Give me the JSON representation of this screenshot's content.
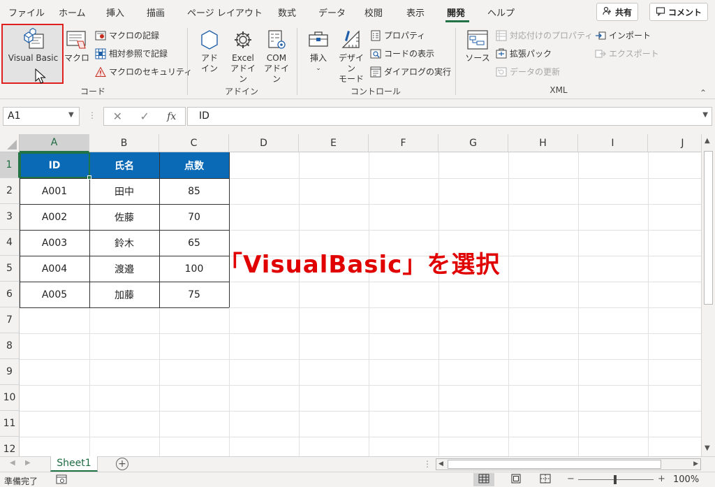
{
  "tabs": [
    "ファイル",
    "ホーム",
    "挿入",
    "描画",
    "ページ レイアウト",
    "数式",
    "データ",
    "校閲",
    "表示",
    "開発",
    "ヘルプ"
  ],
  "active_tab": "開発",
  "header": {
    "share_label": "共有",
    "comment_label": "コメント"
  },
  "ribbon": {
    "code": {
      "label": "コード",
      "visual_basic": "Visual Basic",
      "macro": "マクロ",
      "record_macro": "マクロの記録",
      "relative_ref": "相対参照で記録",
      "macro_security": "マクロのセキュリティ"
    },
    "addins": {
      "label": "アドイン",
      "addin_l1": "アド",
      "addin_l2": "イン",
      "excel_addin_l1": "Excel",
      "excel_addin_l2": "アドイン",
      "com_addin_l1": "COM",
      "com_addin_l2": "アドイン"
    },
    "controls": {
      "label": "コントロール",
      "insert": "挿入",
      "design_mode_l1": "デザイン",
      "design_mode_l2": "モード",
      "properties": "プロパティ",
      "view_code": "コードの表示",
      "run_dialog": "ダイアログの実行"
    },
    "xml": {
      "label": "XML",
      "source": "ソース",
      "map_properties": "対応付けのプロパティ",
      "expansion_pack": "拡張パック",
      "refresh_data": "データの更新",
      "import": "インポート",
      "export": "エクスポート"
    }
  },
  "formula_bar": {
    "name_box": "A1",
    "formula": "ID",
    "fx": "fx"
  },
  "columns": [
    "A",
    "B",
    "C",
    "D",
    "E",
    "F",
    "G",
    "H",
    "I",
    "J"
  ],
  "rows": [
    "1",
    "2",
    "3",
    "4",
    "5",
    "6",
    "7",
    "8",
    "9",
    "10",
    "11",
    "12"
  ],
  "table": {
    "headers": [
      "ID",
      "氏名",
      "点数"
    ],
    "rows": [
      [
        "A001",
        "田中",
        "85"
      ],
      [
        "A002",
        "佐藤",
        "70"
      ],
      [
        "A003",
        "鈴木",
        "65"
      ],
      [
        "A004",
        "渡邉",
        "100"
      ],
      [
        "A005",
        "加藤",
        "75"
      ]
    ]
  },
  "annotation": "「VisualBasic」を選択",
  "sheet_tab": "Sheet1",
  "status": {
    "text": "準備完了",
    "zoom": "100%",
    "zoom_minus": "−",
    "zoom_plus": "+"
  },
  "colors": {
    "accent": "#217346",
    "header_fill": "#0b6ab6",
    "annotation": "#e00000",
    "highlight": "#e01f1f"
  }
}
